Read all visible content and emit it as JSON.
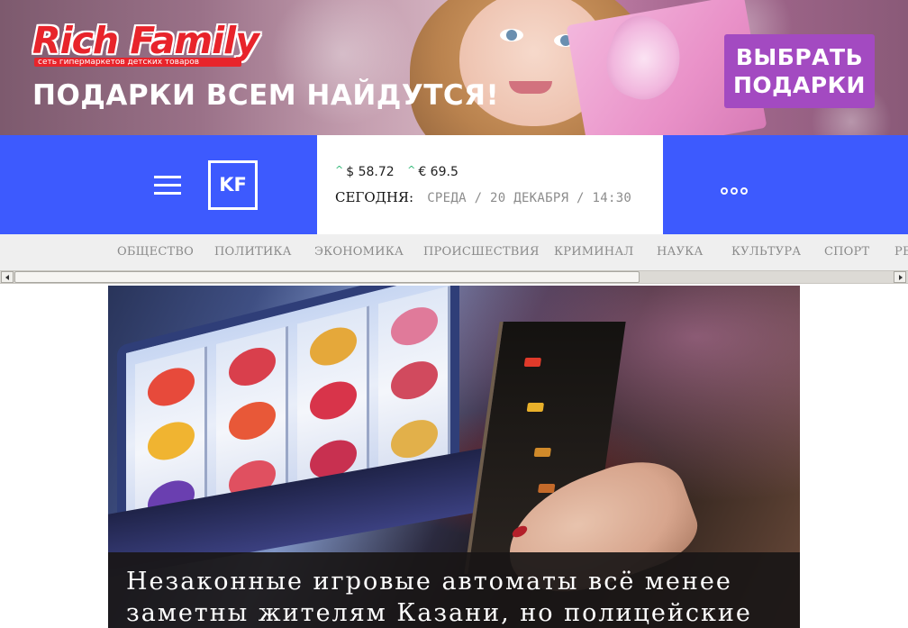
{
  "banner": {
    "brand": "Rich Family",
    "tagline": "сеть гипермаркетов детских товаров",
    "headline": "ПОДАРКИ ВСЕМ НАЙДУТСЯ!",
    "cta_line1": "ВЫБРАТЬ",
    "cta_line2": "ПОДАРКИ"
  },
  "header": {
    "logo": "KF",
    "usd": "$ 58.72",
    "eur": "€ 69.5",
    "today_label": "СЕГОДНЯ:",
    "today_value": "СРЕДА / 20 ДЕКАБРЯ / 14:30",
    "trend_up": "^",
    "colors": {
      "brand_blue": "#3d5afe",
      "rate_up": "#2bb673"
    }
  },
  "nav": {
    "items": [
      "ОБЩЕСТВО",
      "ПОЛИТИКА",
      "ЭКОНОМИКА",
      "ПРОИСШЕСТВИЯ",
      "КРИМИНАЛ",
      "НАУКА",
      "КУЛЬТУРА",
      "СПОРТ",
      "РЕ"
    ]
  },
  "article": {
    "title": "Незаконные игровые автоматы всё менее заметны жителям Казани, но полицейские"
  },
  "icons": {
    "menu": "hamburger-menu-icon",
    "more": "more-dots-icon",
    "scroll_left": "scroll-left-arrow-icon",
    "scroll_right": "scroll-right-arrow-icon"
  }
}
